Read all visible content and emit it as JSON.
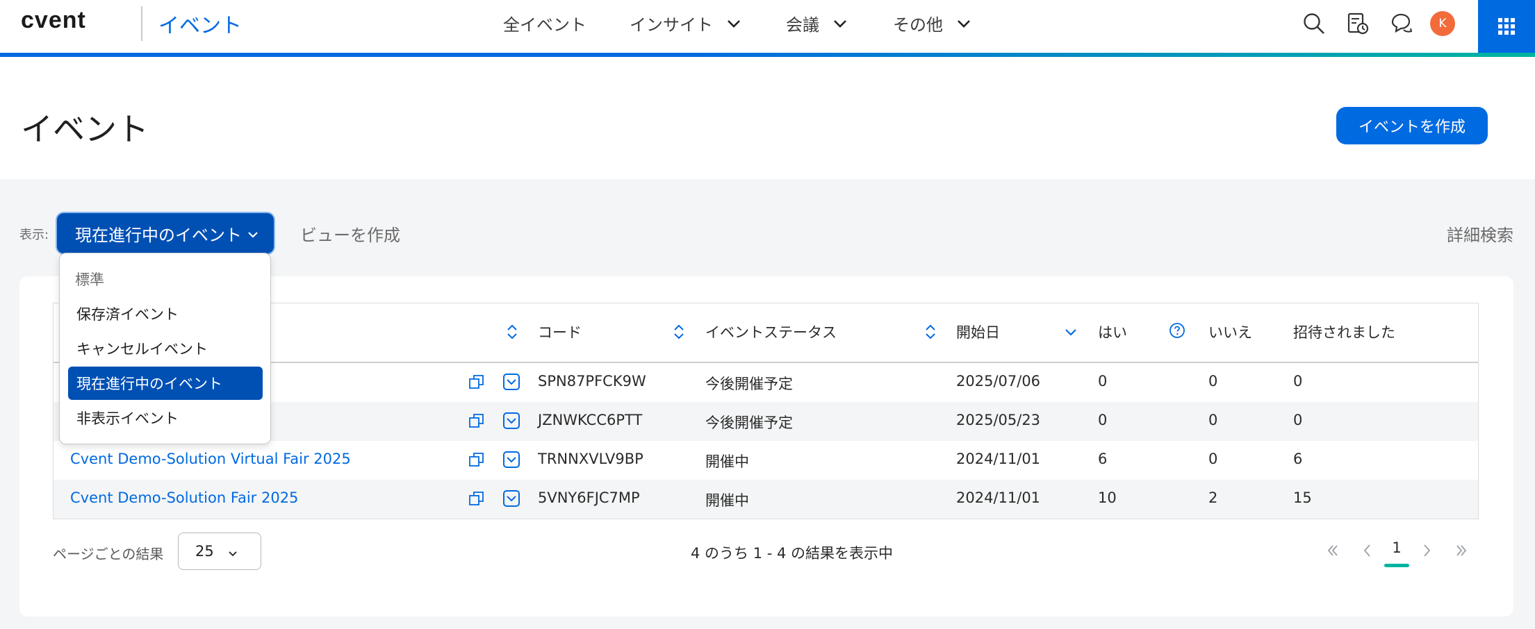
{
  "brand": {
    "logo_text": "cvent",
    "product": "イベント"
  },
  "nav": {
    "items": [
      {
        "label": "全イベント",
        "has_menu": false
      },
      {
        "label": "インサイト",
        "has_menu": true
      },
      {
        "label": "会議",
        "has_menu": true
      },
      {
        "label": "その他",
        "has_menu": true
      }
    ]
  },
  "header_icons": [
    "search-icon",
    "calendar-clock-icon",
    "chat-icon",
    "avatar",
    "app-launcher-icon"
  ],
  "user": {
    "initial": "K",
    "avatar_color": "#f26b3a"
  },
  "page": {
    "title": "イベント",
    "create_button": "イベントを作成"
  },
  "filters": {
    "show_label": "表示:",
    "selected_view": "現在進行中のイベント",
    "create_view": "ビューを作成",
    "advanced_search": "詳細検索"
  },
  "view_dropdown": {
    "group_label": "標準",
    "options": [
      {
        "label": "保存済イベント",
        "selected": false
      },
      {
        "label": "キャンセルイベント",
        "selected": false
      },
      {
        "label": "現在進行中のイベント",
        "selected": true
      },
      {
        "label": "非表示イベント",
        "selected": false
      }
    ]
  },
  "table": {
    "columns": {
      "code": "コード",
      "status": "イベントステータス",
      "start_date": "開始日",
      "yes": "はい",
      "no": "いいえ",
      "invited": "招待されました"
    },
    "rows": [
      {
        "name": "",
        "code": "SPN87PFCK9W",
        "status": "今後開催予定",
        "start_date": "2025/07/06",
        "yes": "0",
        "no": "0",
        "invited": "0"
      },
      {
        "name": "",
        "code": "JZNWKCC6PTT",
        "status": "今後開催予定",
        "start_date": "2025/05/23",
        "yes": "0",
        "no": "0",
        "invited": "0"
      },
      {
        "name": "Cvent Demo-Solution Virtual Fair 2025",
        "code": "TRNNXVLV9BP",
        "status": "開催中",
        "start_date": "2024/11/01",
        "yes": "6",
        "no": "0",
        "invited": "6"
      },
      {
        "name": "Cvent Demo-Solution Fair 2025",
        "code": "5VNY6FJC7MP",
        "status": "開催中",
        "start_date": "2024/11/01",
        "yes": "10",
        "no": "2",
        "invited": "15"
      }
    ]
  },
  "pagination": {
    "per_page_label": "ページごとの結果",
    "per_page_value": "25",
    "summary": "4 のうち 1 - 4 の結果を表示中",
    "current_page": "1"
  },
  "colors": {
    "primary": "#006ae1",
    "selected": "#0050b4",
    "accent_teal": "#00b5a0"
  }
}
